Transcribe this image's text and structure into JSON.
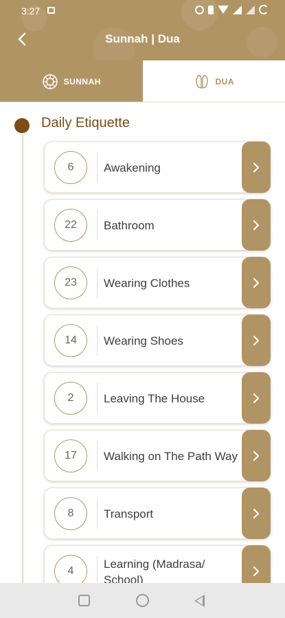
{
  "status": {
    "time": "3:27"
  },
  "header": {
    "title": "Sunnah | Dua",
    "back_icon": "chevron-left-icon"
  },
  "tabs": [
    {
      "label": "SUNNAH",
      "icon": "sunnah-icon",
      "active": true
    },
    {
      "label": "DUA",
      "icon": "dua-hands-icon",
      "active": false
    }
  ],
  "section": {
    "title": "Daily Etiquette"
  },
  "items": [
    {
      "count": "6",
      "label": "Awakening"
    },
    {
      "count": "22",
      "label": "Bathroom"
    },
    {
      "count": "23",
      "label": "Wearing Clothes"
    },
    {
      "count": "14",
      "label": "Wearing Shoes"
    },
    {
      "count": "2",
      "label": "Leaving The House"
    },
    {
      "count": "17",
      "label": "Walking on The Path Way"
    },
    {
      "count": "8",
      "label": "Transport"
    },
    {
      "count": "4",
      "label": "Learning (Madrasa/ School)"
    }
  ],
  "colors": {
    "brand": "#b19464",
    "accent_dark": "#7a4d14",
    "text": "#3d3d3d"
  }
}
